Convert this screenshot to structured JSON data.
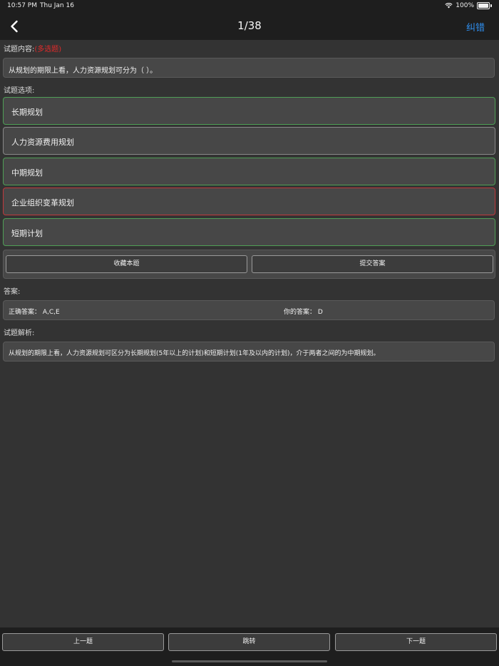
{
  "status": {
    "time": "10:57 PM",
    "date": "Thu Jan 16",
    "battery": "100%"
  },
  "nav": {
    "title": "1/38",
    "action": "纠错"
  },
  "question": {
    "label": "试题内容:",
    "type": "(多选题)",
    "text": "从规划的期限上看，人力资源规划可分为（        ）。"
  },
  "options": {
    "label": "试题选项:",
    "items": [
      {
        "text": "长期规划",
        "state": "correct"
      },
      {
        "text": "人力资源费用规划",
        "state": "neutral"
      },
      {
        "text": "中期规划",
        "state": "correct"
      },
      {
        "text": "企业组织变革规划",
        "state": "wrong"
      },
      {
        "text": "短期计划",
        "state": "correct"
      }
    ]
  },
  "actions": {
    "favorite": "收藏本题",
    "submit": "提交答案"
  },
  "answer": {
    "label": "答案:",
    "correct": "正确答案： A,C,E",
    "yours": "你的答案： D"
  },
  "explanation": {
    "label": "试题解析:",
    "text": "从规划的期限上看，人力资源规划可区分为长期规划(5年以上的计划)和短期计划(1年及以内的计划)，介于两者之间的为中期规划。"
  },
  "bottom": {
    "prev": "上一题",
    "jump": "跳转",
    "next": "下一题"
  },
  "colors": {
    "accent": "#2f8ff0",
    "correct_border": "#4f9f56",
    "wrong_border": "#c0383c",
    "question_type": "#e02a2a"
  }
}
